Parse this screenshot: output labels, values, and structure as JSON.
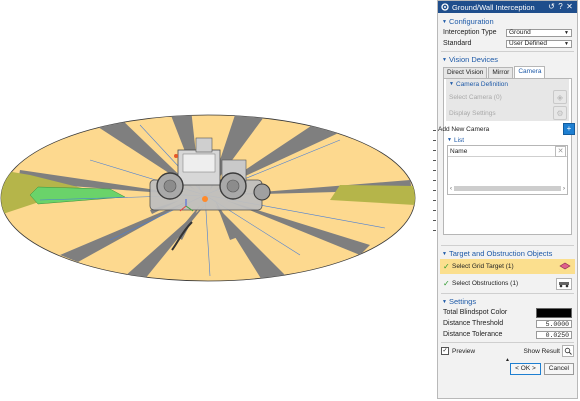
{
  "dialog": {
    "title": "Ground/Wall Interception",
    "colors": {
      "title_bar": "#1f4e8c",
      "section_text": "#1e5aa8",
      "highlight": "#fbdf8e"
    }
  },
  "configuration": {
    "header": "Configuration",
    "interception_type_label": "Interception Type",
    "interception_type_value": "Ground",
    "standard_label": "Standard",
    "standard_value": "User Defined"
  },
  "vision_devices": {
    "header": "Vision Devices",
    "tabs": [
      "Direct Vision",
      "Mirror",
      "Camera"
    ],
    "active_tab": "Camera",
    "camera_definition_header": "Camera Definition",
    "select_camera_label": "Select Camera (0)",
    "display_settings_label": "Display Settings",
    "add_new_camera_label": "Add New Camera",
    "list_header": "List",
    "list_column_name": "Name"
  },
  "target_objects": {
    "header": "Target and Obstruction Objects",
    "select_grid_target": "Select Grid Target (1)",
    "select_obstructions": "Select Obstructions  (1)"
  },
  "settings": {
    "header": "Settings",
    "total_blindspot_color_label": "Total Blindspot Color",
    "total_blindspot_color": "#000000",
    "distance_threshold_label": "Distance Threshold",
    "distance_threshold_value": "5.0000",
    "distance_tolerance_label": "Distance Tolerance",
    "distance_tolerance_value": "0.0250"
  },
  "footer": {
    "preview_label": "Preview",
    "preview_checked": true,
    "show_result_label": "Show Result",
    "ok_label": "< OK >",
    "cancel_label": "Cancel"
  },
  "viewport": {
    "ground_color": "#fdd98f",
    "blind_color": "#7f7f7f",
    "mirror_zone_color": "#6ad36a",
    "camera_zone_color": "#b5b54a"
  }
}
